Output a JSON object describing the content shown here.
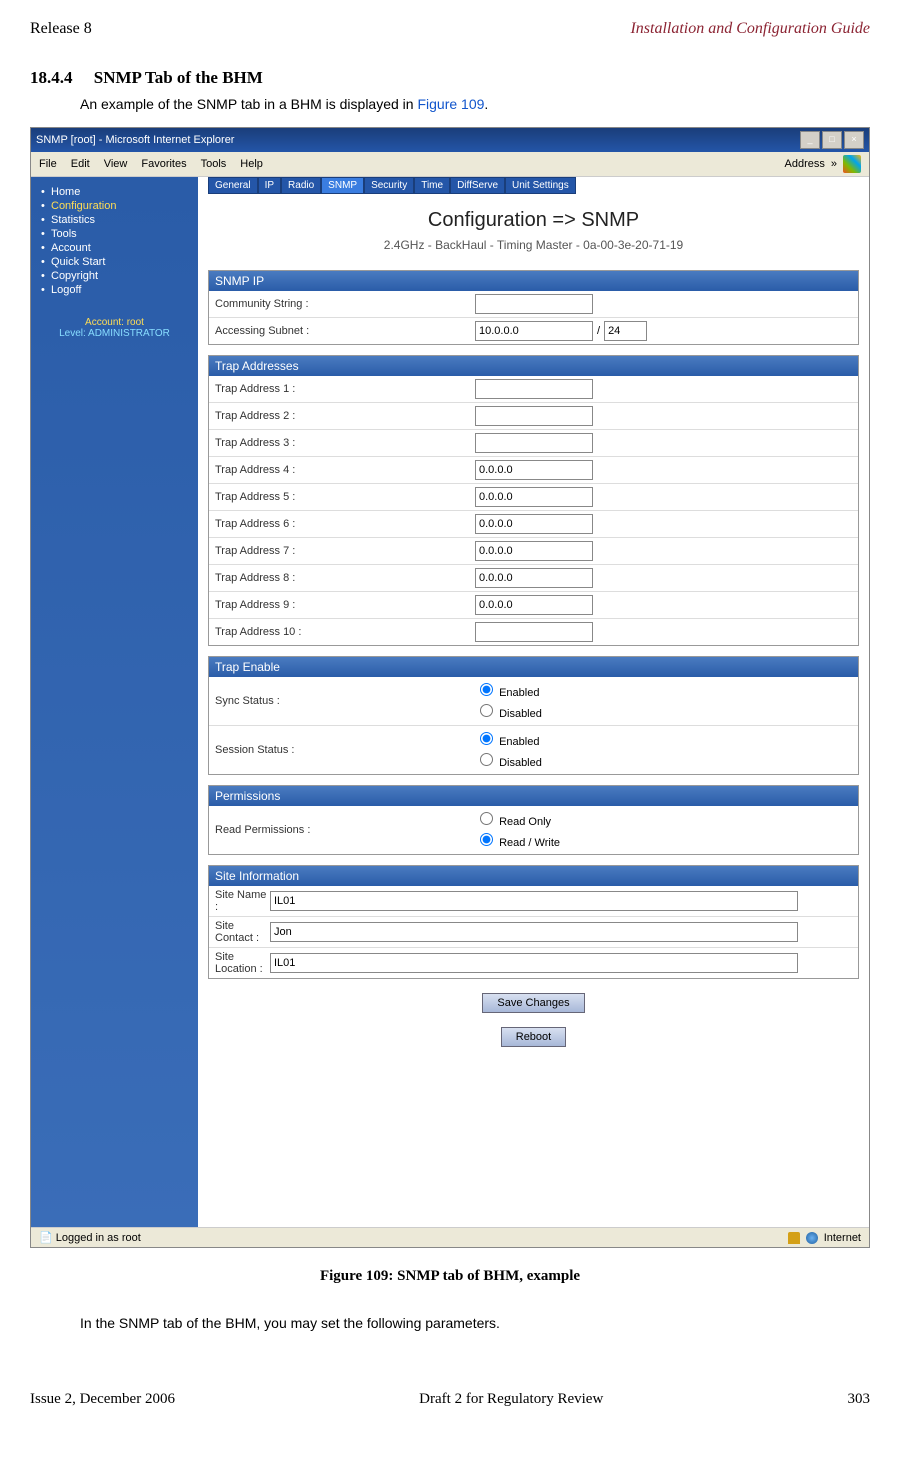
{
  "header": {
    "left": "Release 8",
    "right": "Installation and Configuration Guide"
  },
  "section": {
    "number": "18.4.4",
    "title": "SNMP Tab of the BHM"
  },
  "intro": {
    "prefix": "An example of the SNMP tab in a BHM is displayed in ",
    "link": "Figure 109",
    "suffix": "."
  },
  "window": {
    "title": "SNMP [root] - Microsoft Internet Explorer",
    "menu": [
      "File",
      "Edit",
      "View",
      "Favorites",
      "Tools",
      "Help"
    ],
    "address_label": "Address",
    "chev": "»"
  },
  "sidebar": {
    "items": [
      "Home",
      "Configuration",
      "Statistics",
      "Tools",
      "Account",
      "Quick Start",
      "Copyright",
      "Logoff"
    ],
    "active_index": 1,
    "account_line1": "Account: root",
    "account_line2": "Level: ADMINISTRATOR"
  },
  "tabs": [
    "General",
    "IP",
    "Radio",
    "SNMP",
    "Security",
    "Time",
    "DiffServe",
    "Unit Settings"
  ],
  "active_tab_index": 3,
  "page": {
    "heading": "Configuration => SNMP",
    "sub": "2.4GHz - BackHaul - Timing Master - 0a-00-3e-20-71-19"
  },
  "panels": {
    "snmp_ip": {
      "title": "SNMP IP",
      "community_label": "Community String :",
      "community_value": "",
      "subnet_label": "Accessing Subnet :",
      "subnet_ip": "10.0.0.0",
      "subnet_slash": "/",
      "subnet_mask": "24"
    },
    "trap_addresses": {
      "title": "Trap Addresses",
      "rows": [
        {
          "label": "Trap Address 1 :",
          "value": ""
        },
        {
          "label": "Trap Address 2 :",
          "value": ""
        },
        {
          "label": "Trap Address 3 :",
          "value": ""
        },
        {
          "label": "Trap Address 4 :",
          "value": "0.0.0.0"
        },
        {
          "label": "Trap Address 5 :",
          "value": "0.0.0.0"
        },
        {
          "label": "Trap Address 6 :",
          "value": "0.0.0.0"
        },
        {
          "label": "Trap Address 7 :",
          "value": "0.0.0.0"
        },
        {
          "label": "Trap Address 8 :",
          "value": "0.0.0.0"
        },
        {
          "label": "Trap Address 9 :",
          "value": "0.0.0.0"
        },
        {
          "label": "Trap Address 10 :",
          "value": ""
        }
      ]
    },
    "trap_enable": {
      "title": "Trap Enable",
      "sync_label": "Sync Status :",
      "session_label": "Session Status :",
      "opt_enabled": "Enabled",
      "opt_disabled": "Disabled",
      "sync_selected": "Enabled",
      "session_selected": "Enabled"
    },
    "permissions": {
      "title": "Permissions",
      "label": "Read Permissions :",
      "opt_read_only": "Read Only",
      "opt_read_write": "Read / Write",
      "selected": "Read / Write"
    },
    "site_info": {
      "title": "Site Information",
      "name_label": "Site Name :",
      "name_value": "IL01",
      "contact_label": "Site Contact :",
      "contact_value": "Jon",
      "location_label": "Site Location :",
      "location_value": "IL01"
    }
  },
  "buttons": {
    "save": "Save Changes",
    "reboot": "Reboot"
  },
  "statusbar": {
    "left": "Logged in as root",
    "right": "Internet"
  },
  "figure_caption": "Figure 109: SNMP tab of BHM, example",
  "after_text": "In the SNMP tab of the BHM, you may set the following parameters.",
  "footer": {
    "left": "Issue 2, December 2006",
    "center": "Draft 2 for Regulatory Review",
    "right": "303"
  }
}
